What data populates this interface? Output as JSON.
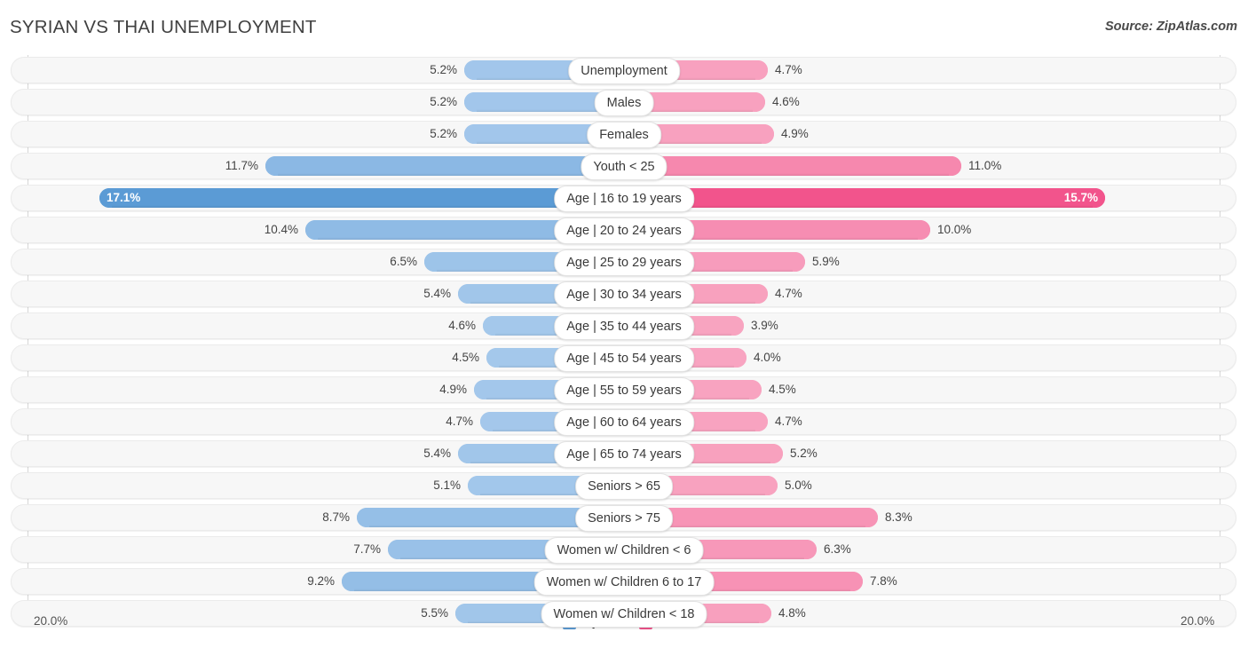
{
  "header": {
    "title": "SYRIAN VS THAI UNEMPLOYMENT",
    "source": "Source: ZipAtlas.com"
  },
  "axis": {
    "min_label": "20.0%",
    "max_label": "20.0%"
  },
  "legend": [
    {
      "label": "Syrian",
      "color": "#5b9bd5"
    },
    {
      "label": "Thai",
      "color": "#f2548c"
    }
  ],
  "colors": {
    "syrian_base": "#a6c9ec",
    "syrian_highlight": "#5b9bd5",
    "thai_base": "#f8a6c2",
    "thai_highlight": "#f2548c",
    "track": "#f7f7f7",
    "gridline": "#d6d6d6"
  },
  "chart_data": {
    "type": "bar",
    "subtype": "diverging-bar",
    "title": "SYRIAN VS THAI UNEMPLOYMENT",
    "xlabel": "",
    "ylabel": "",
    "axis_max": 20.0,
    "unit": "%",
    "grid": true,
    "legend_position": "bottom-center",
    "series": [
      {
        "name": "Syrian",
        "side": "left",
        "values": [
          5.2,
          5.2,
          5.2,
          11.7,
          17.1,
          10.4,
          6.5,
          5.4,
          4.6,
          4.5,
          4.9,
          4.7,
          5.4,
          5.1,
          8.7,
          7.7,
          9.2,
          5.5
        ],
        "labels": [
          "5.2%",
          "5.2%",
          "5.2%",
          "11.7%",
          "17.1%",
          "10.4%",
          "6.5%",
          "5.4%",
          "4.6%",
          "4.5%",
          "4.9%",
          "4.7%",
          "5.4%",
          "5.1%",
          "8.7%",
          "7.7%",
          "9.2%",
          "5.5%"
        ]
      },
      {
        "name": "Thai",
        "side": "right",
        "values": [
          4.7,
          4.6,
          4.9,
          11.0,
          15.7,
          10.0,
          5.9,
          4.7,
          3.9,
          4.0,
          4.5,
          4.7,
          5.2,
          5.0,
          8.3,
          6.3,
          7.8,
          4.8
        ],
        "labels": [
          "4.7%",
          "4.6%",
          "4.9%",
          "11.0%",
          "15.7%",
          "10.0%",
          "5.9%",
          "4.7%",
          "3.9%",
          "4.0%",
          "4.5%",
          "4.7%",
          "5.2%",
          "5.0%",
          "8.3%",
          "6.3%",
          "7.8%",
          "4.8%"
        ]
      }
    ],
    "categories": [
      "Unemployment",
      "Males",
      "Females",
      "Youth < 25",
      "Age | 16 to 19 years",
      "Age | 20 to 24 years",
      "Age | 25 to 29 years",
      "Age | 30 to 34 years",
      "Age | 35 to 44 years",
      "Age | 45 to 54 years",
      "Age | 55 to 59 years",
      "Age | 60 to 64 years",
      "Age | 65 to 74 years",
      "Seniors > 65",
      "Seniors > 75",
      "Women w/ Children < 6",
      "Women w/ Children 6 to 17",
      "Women w/ Children < 18"
    ]
  }
}
